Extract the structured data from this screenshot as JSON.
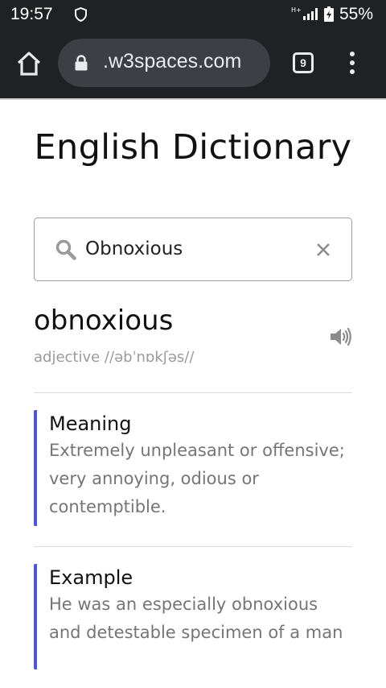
{
  "status_bar": {
    "time": "19:57",
    "network": "H+",
    "battery": "55%"
  },
  "browser": {
    "url": ".w3spaces.com",
    "tab_count": "9"
  },
  "page": {
    "title": "English Dictionary",
    "search": {
      "value": "Obnoxious"
    },
    "entry": {
      "word": "obnoxious",
      "phonetic": "adjective //əbˈnɒkʃəs//"
    },
    "meaning": {
      "title": "Meaning",
      "text": "Extremely unpleasant or offensive; very annoying, odious or contemptible."
    },
    "example": {
      "title": "Example",
      "text": "He was an especially obnoxious and detestable specimen of a man"
    }
  },
  "colors": {
    "chrome_bg": "#202124",
    "url_pill": "#3c3f43",
    "accent": "#4a56e2",
    "muted_text": "#757575"
  },
  "icons": [
    "shield-icon",
    "signal-icon",
    "battery-icon",
    "home-icon",
    "lock-icon",
    "tabs-icon",
    "more-vert-icon",
    "search-icon",
    "close-icon",
    "speaker-icon"
  ]
}
